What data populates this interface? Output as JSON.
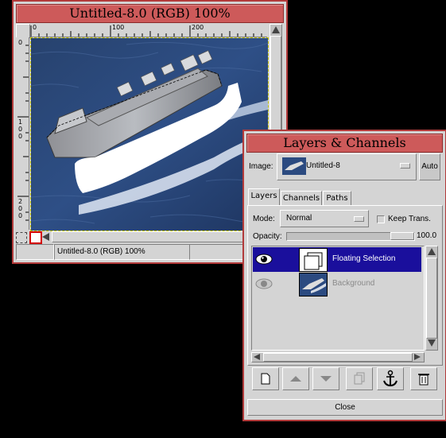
{
  "image_window": {
    "title": "Untitled-8.0 (RGB) 100%",
    "status": "Untitled-8.0 (RGB) 100%",
    "ruler_top": [
      "0",
      "100",
      "200"
    ],
    "ruler_left": [
      "0",
      "1\n0\n0",
      "2\n0\n0"
    ]
  },
  "layers_window": {
    "title": "Layers & Channels",
    "image_label": "Image:",
    "image_value": "Untitled-8",
    "auto_label": "Auto",
    "tabs": [
      "Layers",
      "Channels",
      "Paths"
    ],
    "mode_label": "Mode:",
    "mode_value": "Normal",
    "keep_trans_label": "Keep Trans.",
    "opacity_label": "Opacity:",
    "opacity_value": "100.0",
    "opacity_fraction": 1.0,
    "layers": [
      {
        "name": "Floating Selection",
        "selected": true
      },
      {
        "name": "Background",
        "selected": false
      }
    ],
    "close_label": "Close"
  },
  "colors": {
    "titlebar": "#cd5a5a",
    "selection": "#1a0f9c",
    "window_bg": "#d4d4d4"
  }
}
